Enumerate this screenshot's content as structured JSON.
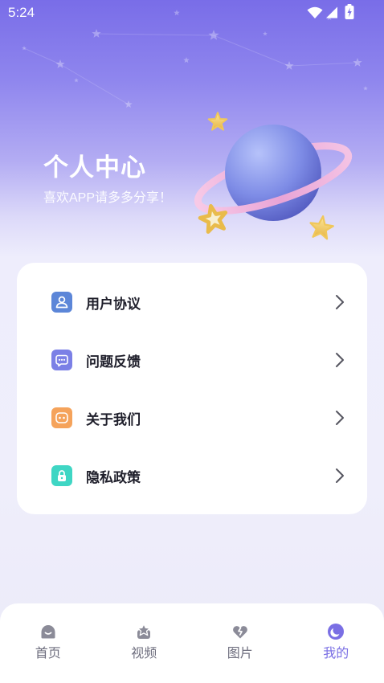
{
  "status_bar": {
    "time": "5:24",
    "icons": [
      "wifi-icon",
      "cellular-signal-icon",
      "battery-charging-icon"
    ]
  },
  "header": {
    "title": "个人中心",
    "subtitle": "喜欢APP请多多分享！",
    "illustration": "planet-with-stars"
  },
  "menu": {
    "items": [
      {
        "label": "用户协议",
        "icon": "user-agreement-icon",
        "color": "#5c86d8"
      },
      {
        "label": "问题反馈",
        "icon": "feedback-icon",
        "color": "#7b80e6"
      },
      {
        "label": "关于我们",
        "icon": "about-us-icon",
        "color": "#f5a35b"
      },
      {
        "label": "隐私政策",
        "icon": "privacy-lock-icon",
        "color": "#3fd6c4"
      }
    ]
  },
  "bottom_nav": {
    "items": [
      {
        "label": "首页",
        "icon": "home-icon",
        "active": false
      },
      {
        "label": "视频",
        "icon": "video-icon",
        "active": false
      },
      {
        "label": "图片",
        "icon": "picture-icon",
        "active": false
      },
      {
        "label": "我的",
        "icon": "profile-icon",
        "active": true
      }
    ]
  },
  "colors": {
    "accent": "#7a6fe4",
    "inactive_icon": "#8b8b98",
    "inactive_label": "#6e6e7e",
    "menu_label": "#1f1f2b",
    "chevron": "#555560"
  }
}
